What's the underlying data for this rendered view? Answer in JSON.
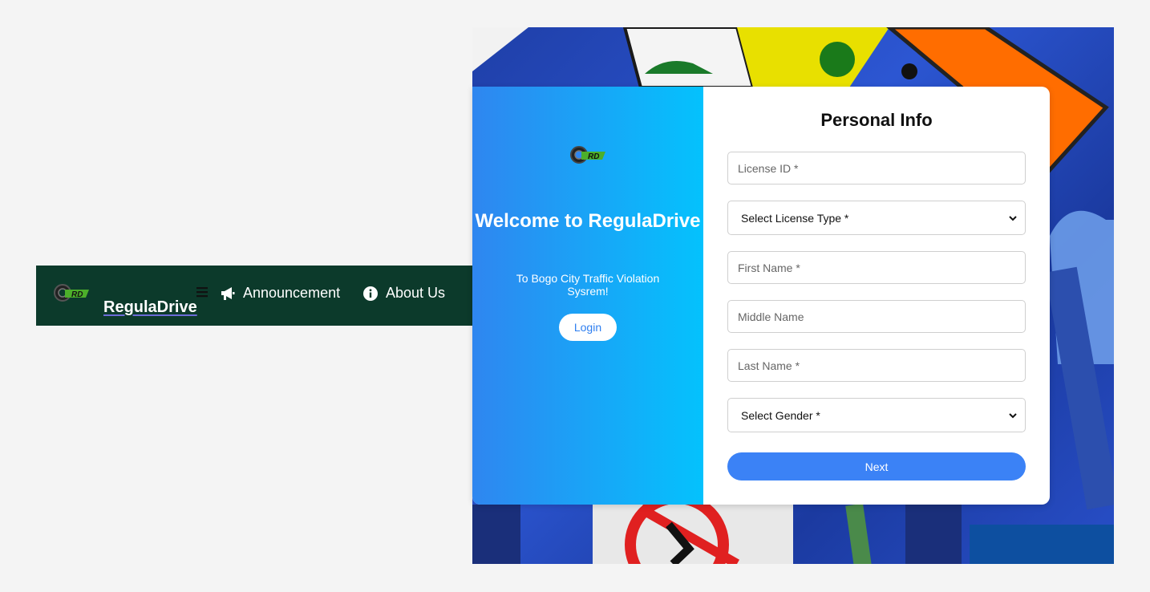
{
  "navbar": {
    "brand": "RegulaDrive",
    "logo_text": "RD",
    "links": [
      {
        "label": "Announcement",
        "icon": "megaphone-icon"
      },
      {
        "label": "About Us",
        "icon": "info-icon"
      }
    ],
    "menu_icon": "hamburger-icon",
    "background_color": "#0c3a2b"
  },
  "welcome_pane": {
    "logo_text": "RD",
    "heading": "Welcome to RegulaDrive",
    "tagline": "To Bogo City Traffic Violation Sysrem!",
    "login_label": "Login",
    "gradient": [
      "#2f86f0",
      "#04c2fd"
    ]
  },
  "form": {
    "title": "Personal Info",
    "license_id_placeholder": "License ID *",
    "license_type_selected": "Select License Type *",
    "first_name_placeholder": "First Name *",
    "middle_name_placeholder": "Middle Name",
    "last_name_placeholder": "Last Name *",
    "gender_selected": "Select Gender *",
    "next_label": "Next",
    "accent_color": "#3b82f6"
  },
  "background": {
    "description_icon": "traffic-signs-image"
  }
}
